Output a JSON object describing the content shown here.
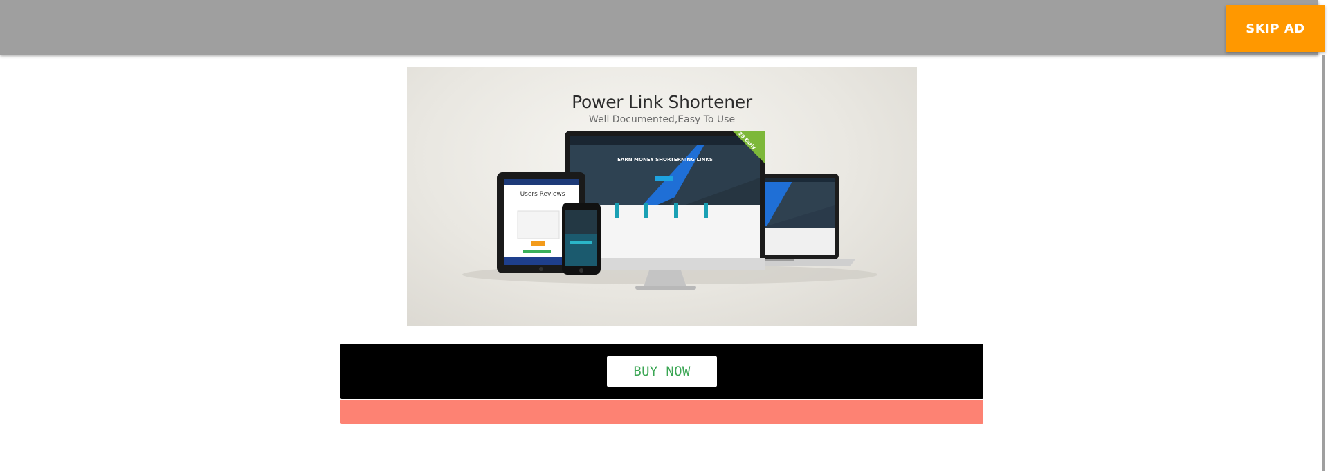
{
  "top_bar": {
    "skip_ad_label": "SKIP AD"
  },
  "ad": {
    "title": "Power Link Shortener",
    "subtitle": "Well Documented,Easy To Use",
    "monitor_headline": "EARN MONEY SHORTERNING LINKS",
    "ribbon": "29 Early",
    "tablet_heading": "Users Reviews"
  },
  "cta": {
    "buy_now_label": "BUY NOW"
  },
  "colors": {
    "top_bar": "#9f9f9f",
    "skip_ad": "#ff9800",
    "cta_background": "#000000",
    "buy_now_text": "#3ba654",
    "bottom_strip": "#fd8273"
  }
}
